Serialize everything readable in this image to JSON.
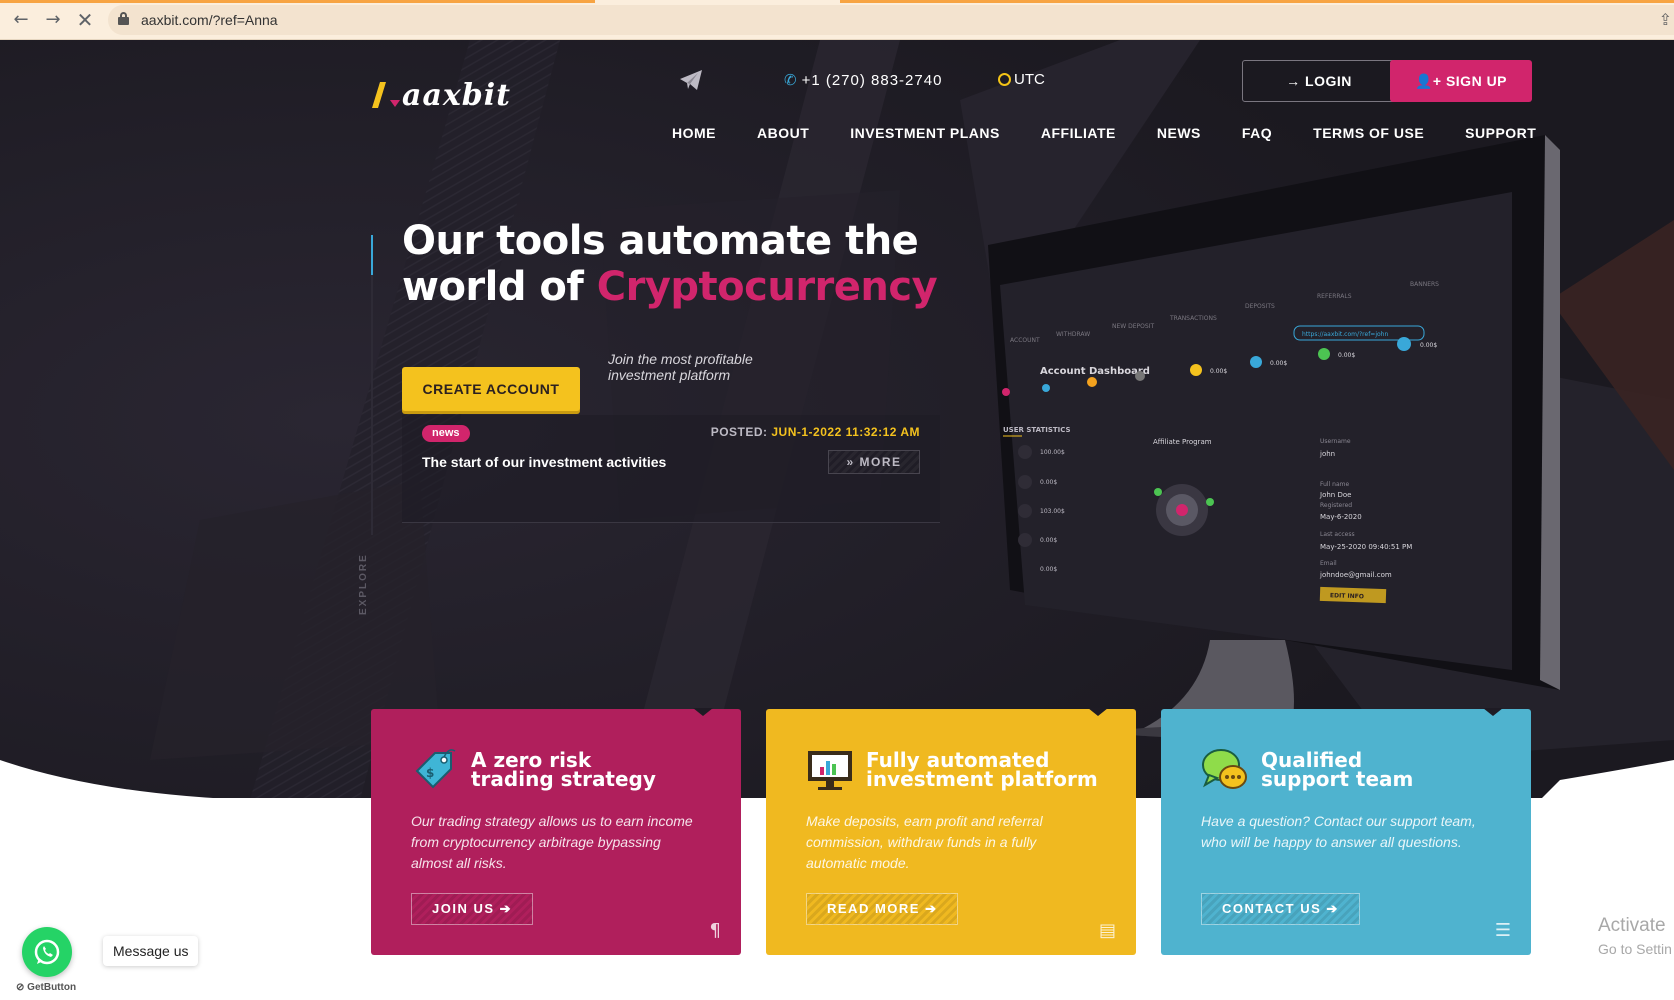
{
  "browser": {
    "url": "aaxbit.com/?ref=Anna",
    "back_icon": "arrow-left",
    "forward_icon": "arrow-right",
    "stop_icon": "close"
  },
  "header": {
    "logo_text": "aaxbit",
    "phone": "+1 (270) 883-2740",
    "timezone": "UTC",
    "login_label": "LOGIN",
    "signup_label": "SIGN UP"
  },
  "nav": [
    "HOME",
    "ABOUT",
    "INVESTMENT PLANS",
    "AFFILIATE",
    "NEWS",
    "FAQ",
    "TERMS OF USE",
    "SUPPORT"
  ],
  "hero": {
    "headline_line1": "Our tools automate the",
    "headline_prefix": "world of ",
    "headline_highlight": "Cryptocurrency",
    "cta_label": "CREATE ACCOUNT",
    "tagline": "Join the most profitable investment platform",
    "explore_label": "EXPLORE"
  },
  "news": {
    "badge": "news",
    "posted_label": "POSTED:",
    "posted_date": "JUN-1-2022 11:32:12 AM",
    "title": "The start of our investment activities",
    "more_label": "MORE"
  },
  "cards": [
    {
      "title_line1": "A zero risk",
      "title_line2": "trading strategy",
      "text": "Our trading strategy allows us to earn income from cryptocurrency arbitrage bypassing almost all risks.",
      "button": "JOIN US"
    },
    {
      "title_line1": "Fully automated",
      "title_line2": "investment platform",
      "text": "Make deposits, earn profit and referral commission, withdraw funds in a fully automatic mode.",
      "button": "READ MORE"
    },
    {
      "title_line1": "Qualified",
      "title_line2": "support team",
      "text": "Have a question? Contact our support team, who will be happy to answer all questions.",
      "button": "CONTACT US"
    }
  ],
  "widget": {
    "message_label": "Message us",
    "brand": "GetButton"
  },
  "os_overlay": {
    "line1": "Activate",
    "line2": "Go to Settin"
  },
  "colors": {
    "brand_pink": "#d1256c",
    "brand_yellow": "#f4c21e",
    "brand_blue": "#4fb3cf",
    "hero_bg": "#1e1b24"
  }
}
